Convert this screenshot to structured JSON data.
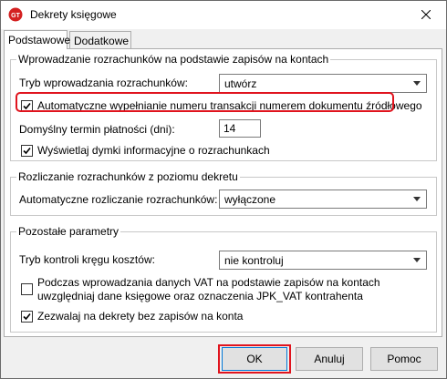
{
  "window": {
    "title": "Dekrety księgowe",
    "icon": "app-logo-icon",
    "close_icon": "close-icon"
  },
  "tabs": [
    {
      "label": "Podstawowe",
      "active": true
    },
    {
      "label": "Dodatkowe",
      "active": false
    }
  ],
  "group1": {
    "title": "Wprowadzanie rozrachunków na podstawie zapisów na kontach",
    "mode_label": "Tryb wprowadzania rozrachunków:",
    "mode_value": "utwórz",
    "auto_number_label": "Automatyczne wypełnianie numeru transakcji numerem dokumentu źródłowego",
    "auto_number_checked": true,
    "term_label": "Domyślny termin płatności (dni):",
    "term_value": "14",
    "tooltips_label": "Wyświetlaj dymki informacyjne o rozrachunkach",
    "tooltips_checked": true
  },
  "group2": {
    "title": "Rozliczanie rozrachunków z poziomu dekretu",
    "auto_settle_label": "Automatyczne rozliczanie rozrachunków:",
    "auto_settle_value": "wyłączone"
  },
  "group3": {
    "title": "Pozostałe parametry",
    "cost_control_label": "Tryb kontroli kręgu kosztów:",
    "cost_control_value": "nie kontroluj",
    "vat_label_line1": "Podczas wprowadzania danych VAT na podstawie zapisów na kontach",
    "vat_label_line2": "uwzględniaj dane księgowe oraz oznaczenia JPK_VAT kontrahenta",
    "vat_checked": false,
    "allow_empty_label": "Zezwalaj na dekrety bez zapisów na konta",
    "allow_empty_checked": true
  },
  "buttons": {
    "ok": "OK",
    "cancel": "Anuluj",
    "help": "Pomoc"
  },
  "colors": {
    "highlight": "#e0141e",
    "default_button_border": "#0078d7"
  }
}
